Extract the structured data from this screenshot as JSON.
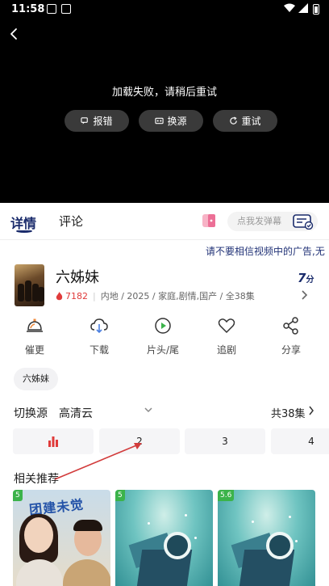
{
  "status_bar": {
    "time": "11:58"
  },
  "player": {
    "error_message": "加载失败，请稍后重试",
    "buttons": [
      {
        "label": "报错",
        "icon": "feedback-icon"
      },
      {
        "label": "换源",
        "icon": "switch-source-icon"
      },
      {
        "label": "重试",
        "icon": "refresh-icon"
      }
    ]
  },
  "tabs": [
    {
      "label": "详情"
    },
    {
      "label": "评论"
    }
  ],
  "danmu": {
    "placeholder": "点我发弹幕"
  },
  "marquee": "请不要相信视频中的广告,无",
  "show": {
    "title": "六姊妹",
    "heat": "7182",
    "meta": "内地 / 2025 / 家庭,剧情,国产 / 全38集",
    "score": "7",
    "score_unit": "分"
  },
  "actions": [
    {
      "label": "催更",
      "icon": "bell-icon"
    },
    {
      "label": "下载",
      "icon": "cloud-download-icon"
    },
    {
      "label": "片头/尾",
      "icon": "play-circle-icon"
    },
    {
      "label": "追剧",
      "icon": "heart-icon"
    },
    {
      "label": "分享",
      "icon": "share-icon"
    }
  ],
  "tag": "六姊妹",
  "source": {
    "label": "切换源",
    "name": "高清云",
    "episode_count": "共38集"
  },
  "episodes": [
    {
      "label": "",
      "playing": true
    },
    {
      "label": "2"
    },
    {
      "label": "3"
    },
    {
      "label": "4"
    }
  ],
  "recommend": {
    "title": "相关推荐",
    "items": [
      {
        "badge": "5",
        "poster_text": "团建未觉"
      },
      {
        "badge": "5"
      },
      {
        "badge": "5.6"
      }
    ]
  },
  "colors": {
    "accent": "#1a2b6b",
    "heat": "#e03b3b",
    "playing": "#e03b3b",
    "annotation": "#d23c3c",
    "badge": "#3bb34a"
  }
}
